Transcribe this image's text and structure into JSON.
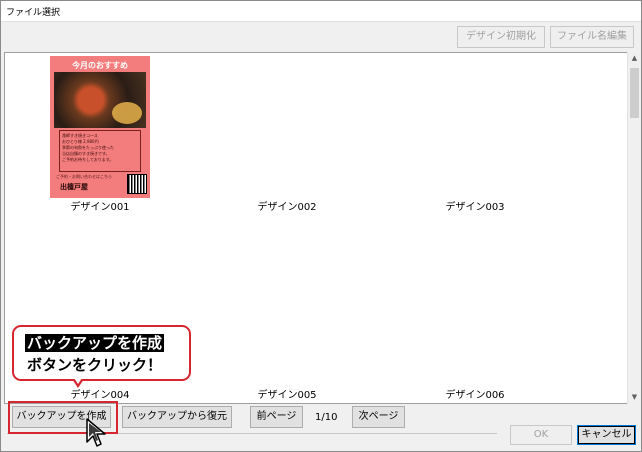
{
  "window": {
    "title": "ファイル選択"
  },
  "toolbar": {
    "reset_design_label": "デザイン初期化",
    "rename_file_label": "ファイル名編集"
  },
  "designs": [
    {
      "label": "デザイン001"
    },
    {
      "label": "デザイン002"
    },
    {
      "label": "デザイン003"
    },
    {
      "label": "デザイン004"
    },
    {
      "label": "デザイン005"
    },
    {
      "label": "デザイン006"
    }
  ],
  "thumbnail": {
    "heading": "今月のおすすめ",
    "body_lines": [
      "漁師すき焼きコース",
      "おひとり様 2,980円",
      "季節の旬魚をたっぷり使った",
      "当店自慢のすき焼きです。",
      "ご予約お待ちしております。"
    ],
    "note": "ご予約・お問い合わせはこちら",
    "shop_name": "出檀戸屋"
  },
  "footer": {
    "backup_create_label": "バックアップを作成",
    "backup_restore_label": "バックアップから復元",
    "prev_page_label": "前ページ",
    "page_indicator": "1/10",
    "next_page_label": "次ページ",
    "ok_label": "OK",
    "cancel_label": "キャンセル"
  },
  "callout": {
    "line1": "バックアップを作成",
    "line2": "ボタンをクリック！"
  },
  "icons": {
    "scroll_up": "chevron-up-icon",
    "scroll_down": "chevron-down-icon",
    "cursor": "mouse-pointer-icon"
  },
  "colors": {
    "callout_border": "#d6262f",
    "flyer_background": "#f37c7c"
  }
}
